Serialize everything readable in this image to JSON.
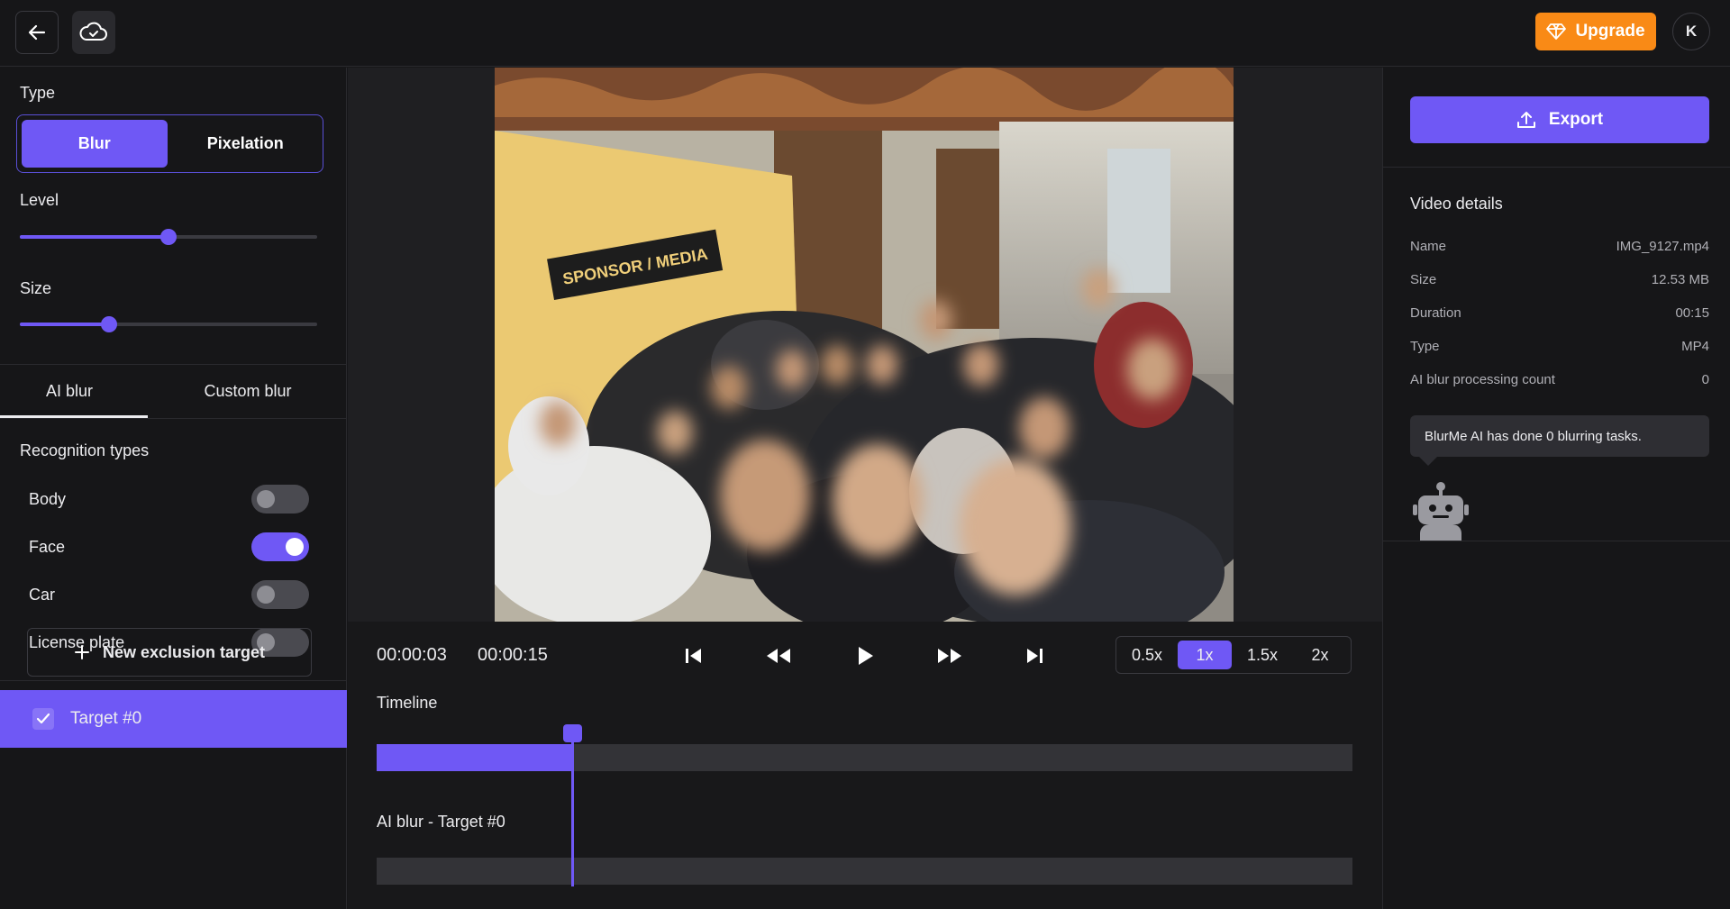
{
  "topbar": {
    "upgrade_label": "Upgrade",
    "avatar_initial": "K"
  },
  "left": {
    "type_label": "Type",
    "type_options": [
      "Blur",
      "Pixelation"
    ],
    "type_selected": "Blur",
    "level_label": "Level",
    "level_value": 0.5,
    "size_label": "Size",
    "size_value": 0.3,
    "tabs": [
      "AI blur",
      "Custom blur"
    ],
    "tab_selected": "AI blur",
    "recognition_label": "Recognition types",
    "recognition": [
      {
        "label": "Body",
        "on": false
      },
      {
        "label": "Face",
        "on": true
      },
      {
        "label": "Car",
        "on": false
      },
      {
        "label": "License plate",
        "on": false
      }
    ],
    "new_target_label": "New exclusion target",
    "target_label": "Target #0"
  },
  "player": {
    "video_sign": "SPONSOR / MEDIA",
    "current_time": "00:00:03",
    "total_time": "00:00:15",
    "speeds": [
      "0.5x",
      "1x",
      "1.5x",
      "2x"
    ],
    "speed_selected": "1x",
    "timeline_label": "Timeline",
    "track_label": "AI blur - Target #0",
    "progress": 0.2
  },
  "right": {
    "export_label": "Export",
    "details_title": "Video details",
    "details": [
      {
        "key": "Name",
        "value": "IMG_9127.mp4"
      },
      {
        "key": "Size",
        "value": "12.53 MB"
      },
      {
        "key": "Duration",
        "value": "00:15"
      },
      {
        "key": "Type",
        "value": "MP4"
      },
      {
        "key": "AI blur processing count",
        "value": "0"
      }
    ],
    "tooltip": "BlurMe AI has done 0 blurring tasks."
  },
  "colors": {
    "accent": "#6f58f5",
    "upgrade": "#f98a16",
    "background": "#161618"
  }
}
